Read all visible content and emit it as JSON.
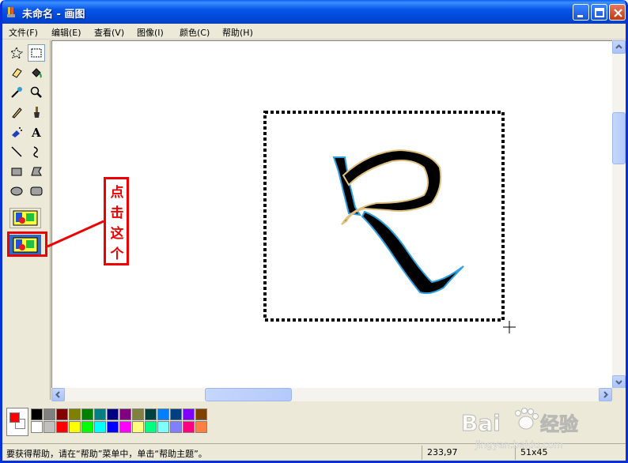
{
  "window": {
    "title": "未命名 - 画图"
  },
  "menu": {
    "items": [
      "文件(F)",
      "编辑(E)",
      "查看(V)",
      "图像(I)",
      "颜色(C)",
      "帮助(H)"
    ]
  },
  "toolbox": {
    "tools": [
      "free-form-select-icon",
      "rectangle-select-icon",
      "eraser-icon",
      "fill-bucket-icon",
      "color-picker-icon",
      "magnifier-icon",
      "pencil-icon",
      "brush-icon",
      "airbrush-icon",
      "text-icon",
      "line-icon",
      "curve-icon",
      "rectangle-icon",
      "polygon-icon",
      "ellipse-icon",
      "rounded-rectangle-icon"
    ],
    "active_tool": "rectangle-select-icon",
    "options": [
      "opaque-selection-icon",
      "transparent-selection-icon"
    ],
    "selected_option": "transparent-selection-icon"
  },
  "annotation": {
    "text": "点击这个",
    "color": "#e00000"
  },
  "palette": {
    "foreground": "#ff0000",
    "background": "#ffffff",
    "row1": [
      "#000000",
      "#808080",
      "#800000",
      "#808000",
      "#008000",
      "#008080",
      "#000080",
      "#800080",
      "#808040",
      "#004040",
      "#0080ff",
      "#004080",
      "#8000ff",
      "#804000"
    ],
    "row2": [
      "#ffffff",
      "#c0c0c0",
      "#ff0000",
      "#ffff00",
      "#00ff00",
      "#00ffff",
      "#0000ff",
      "#ff00ff",
      "#ffff80",
      "#00ff80",
      "#80ffff",
      "#8080ff",
      "#ff0080",
      "#ff8040"
    ]
  },
  "status": {
    "help": "要获得帮助，请在“帮助”菜单中，单击“帮助主题”。",
    "coords": "233,97",
    "size": "51x45"
  },
  "watermark": {
    "brand": "Bai",
    "brand_cn": "经验",
    "url": "jingyan.baidu.com"
  }
}
